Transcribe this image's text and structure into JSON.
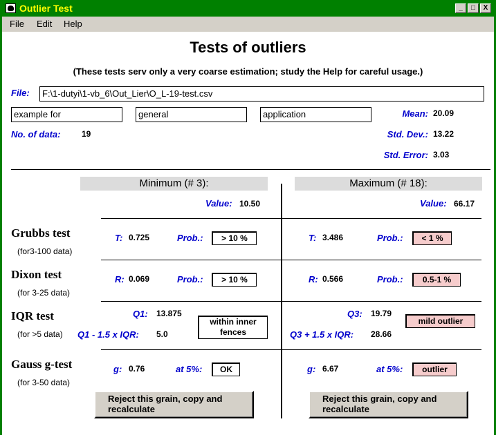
{
  "window": {
    "title": "Outlier Test",
    "minimize": "_",
    "maximize": "□",
    "close": "X"
  },
  "menu": [
    "File",
    "Edit",
    "Help"
  ],
  "page": {
    "title": "Tests of outliers",
    "subtitle": "(These tests serv only a very coarse estimation; study the Help for careful usage.)"
  },
  "file": {
    "label": "File:",
    "path": "F:\\1-dutyi\\1-vb_6\\Out_Lier\\O_L-19-test.csv"
  },
  "desc_fields": [
    "example for",
    "general",
    "application"
  ],
  "stats": {
    "n_label": "No. of data:",
    "n_value": "19",
    "mean_label": "Mean:",
    "mean_value": "20.09",
    "sd_label": "Std. Dev.:",
    "sd_value": "13.22",
    "se_label": "Std. Error:",
    "se_value": "3.03"
  },
  "minimum": {
    "header": "Minimum (# 3):",
    "value_label": "Value:",
    "value": "10.50"
  },
  "maximum": {
    "header": "Maximum (# 18):",
    "value_label": "Value:",
    "value": "66.17"
  },
  "grubbs": {
    "name": "Grubbs test",
    "range": "(for3-100 data)",
    "stat_label": "T:",
    "prob_label": "Prob.:",
    "min_stat": "0.725",
    "min_prob": "> 10 %",
    "max_stat": "3.486",
    "max_prob": "< 1 %"
  },
  "dixon": {
    "name": "Dixon test",
    "range": "(for 3-25 data)",
    "stat_label": "R:",
    "prob_label": "Prob.:",
    "min_stat": "0.069",
    "min_prob": "> 10 %",
    "max_stat": "0.566",
    "max_prob": "0.5-1 %"
  },
  "iqr": {
    "name": "IQR test",
    "range": "(for >5 data)",
    "q1_label": "Q1:",
    "q1_value": "13.875",
    "lower_label": "Q1 - 1.5 x  IQR:",
    "lower_value": "5.0",
    "min_result": "within inner fences",
    "q3_label": "Q3:",
    "q3_value": "19.79",
    "upper_label": "Q3 + 1.5 x  IQR:",
    "upper_value": "28.66",
    "max_result": "mild outlier"
  },
  "gauss": {
    "name": "Gauss g-test",
    "range": "(for 3-50 data)",
    "stat_label": "g:",
    "sig_label": "at 5%:",
    "min_stat": "0.76",
    "min_result": "OK",
    "max_stat": "6.67",
    "max_result": "outlier"
  },
  "buttons": {
    "reject_min": "Reject this grain, copy and recalculate",
    "reject_max": "Reject this grain, copy and recalculate"
  },
  "colors": {
    "titlebar": "#008000",
    "title_text": "#ffff00",
    "label_blue": "#0000cc",
    "alert_pink": "#f6cccc"
  }
}
